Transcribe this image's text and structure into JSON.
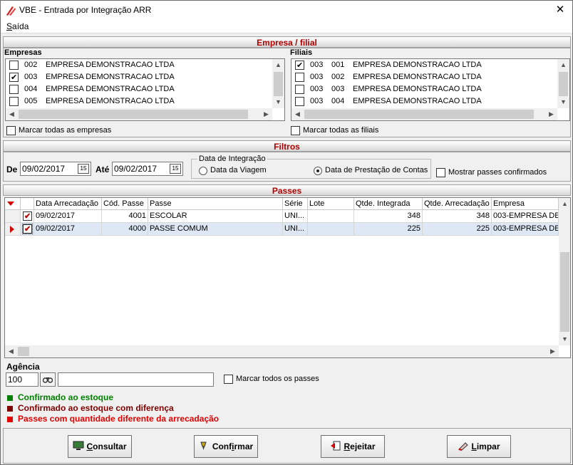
{
  "window": {
    "title": "VBE - Entrada por Integração ARR",
    "close_glyph": "✕"
  },
  "menu": {
    "items": [
      {
        "label_first": "S",
        "label_rest": "aída"
      }
    ]
  },
  "empresa_filial": {
    "header": "Empresa / filial",
    "empresas": {
      "label": "Empresas",
      "items": [
        {
          "code": "002",
          "name": "EMPRESA DEMONSTRACAO LTDA",
          "checked": false
        },
        {
          "code": "003",
          "name": "EMPRESA DEMONSTRACAO LTDA",
          "checked": true
        },
        {
          "code": "004",
          "name": "EMPRESA DEMONSTRACAO LTDA",
          "checked": false
        },
        {
          "code": "005",
          "name": "EMPRESA DEMONSTRACAO LTDA",
          "checked": false
        }
      ],
      "mark_all_label": "Marcar todas as empresas"
    },
    "filiais": {
      "label": "Filiais",
      "items": [
        {
          "emp": "003",
          "code": "001",
          "name": "EMPRESA DEMONSTRACAO LTDA",
          "checked": true
        },
        {
          "emp": "003",
          "code": "002",
          "name": "EMPRESA DEMONSTRACAO LTDA",
          "checked": false
        },
        {
          "emp": "003",
          "code": "003",
          "name": "EMPRESA DEMONSTRACAO LTDA",
          "checked": false
        },
        {
          "emp": "003",
          "code": "004",
          "name": "EMPRESA DEMONSTRACAO LTDA",
          "checked": false
        }
      ],
      "mark_all_label": "Marcar todas as filiais"
    }
  },
  "filtros": {
    "header": "Filtros",
    "de_label": "De",
    "de_value": "09/02/2017",
    "ate_label": "Até",
    "ate_value": "09/02/2017",
    "calendar_glyph": "15",
    "integracao_group": "Data de Integração",
    "radio_viagem": "Data da Viagem",
    "radio_prestacao": "Data de Prestação de Contas",
    "selected_radio": "prestacao",
    "mostrar_label": "Mostrar passes confirmados"
  },
  "passes": {
    "header": "Passes",
    "columns": [
      "Data Arrecadação",
      "Cód. Passe",
      "Passe",
      "Série",
      "Lote",
      "Qtde. Integrada",
      "Qtde. Arrecadação",
      "Empresa"
    ],
    "rows": [
      {
        "data": "09/02/2017",
        "cod": "4001",
        "passe": "ESCOLAR",
        "serie": "UNI...",
        "lote": "",
        "qtde_int": "348",
        "qtde_arr": "348",
        "empresa": "003-EMPRESA DE",
        "checked": true,
        "current": false
      },
      {
        "data": "09/02/2017",
        "cod": "4000",
        "passe": "PASSE COMUM",
        "serie": "UNI...",
        "lote": "",
        "qtde_int": "225",
        "qtde_arr": "225",
        "empresa": "003-EMPRESA DE",
        "checked": true,
        "current": true
      }
    ]
  },
  "agencia": {
    "label": "Agência",
    "value": "100",
    "description": "",
    "mark_all_label": "Marcar todos os passes"
  },
  "legend": [
    {
      "text": "Confirmado ao estoque",
      "color": "#008000"
    },
    {
      "text": "Confirmado ao estoque com diferença",
      "color": "#800000"
    },
    {
      "text": "Passes com quantidade diferente da arrecadação",
      "color": "#e00000"
    }
  ],
  "buttons": {
    "consultar": {
      "first": "C",
      "rest": "onsultar"
    },
    "confirmar": {
      "pre": "Conf",
      "ul": "i",
      "post": "rmar"
    },
    "rejeitar": {
      "first": "R",
      "rest": "ejeitar"
    },
    "limpar": {
      "first": "L",
      "rest": "impar"
    }
  },
  "colors": {
    "header_text": "#b00000",
    "accent_red": "#c00000"
  }
}
